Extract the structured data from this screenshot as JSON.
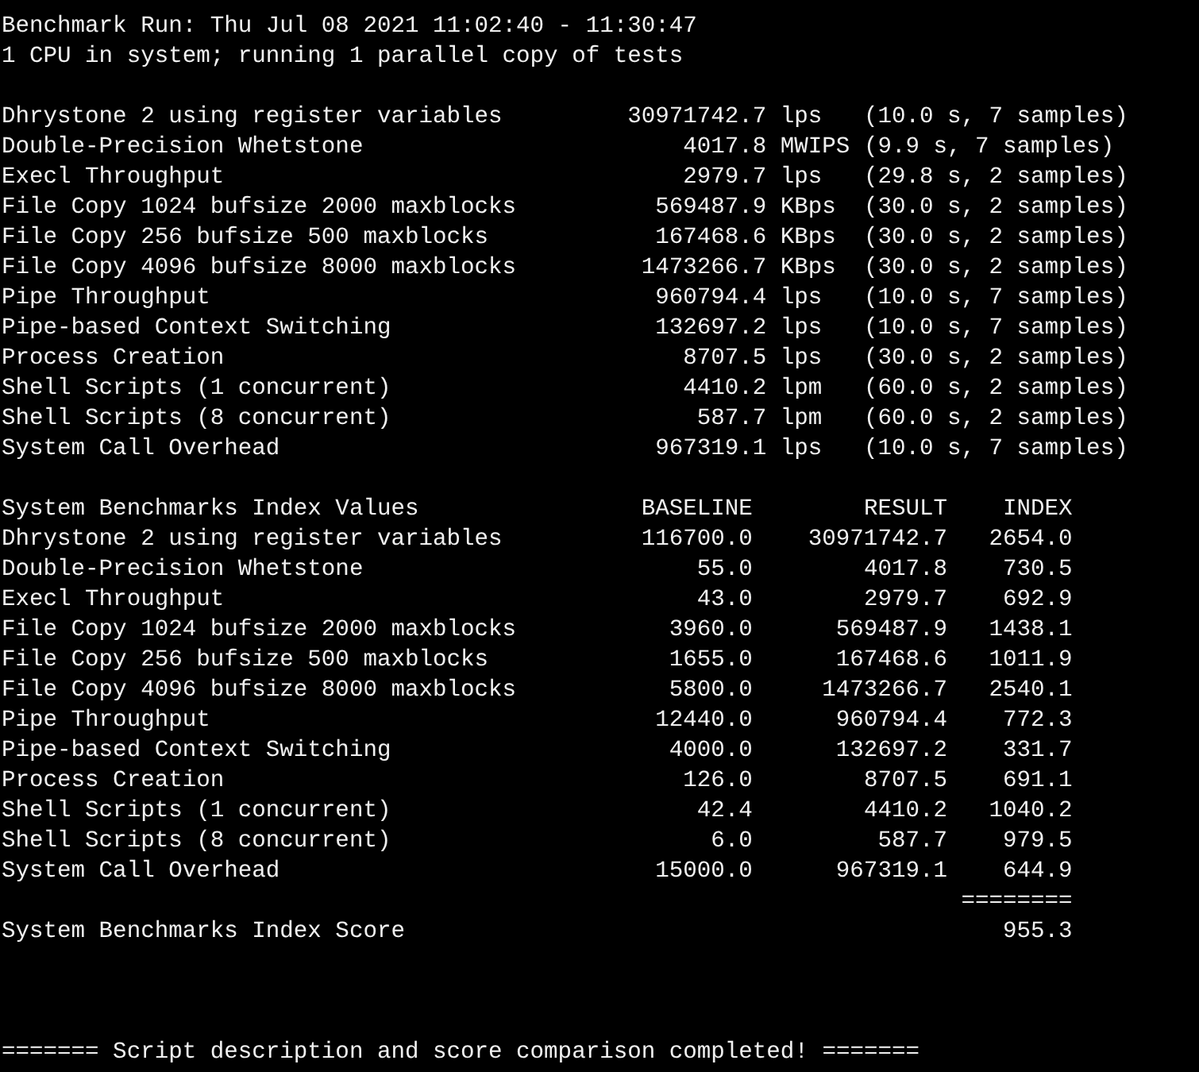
{
  "header_lines": [
    "Benchmark Run: Thu Jul 08 2021 11:02:40 - 11:30:47",
    "1 CPU in system; running 1 parallel copy of tests"
  ],
  "results": [
    {
      "name": "Dhrystone 2 using register variables",
      "value": "30971742.7",
      "unit": "lps",
      "detail": "(10.0 s, 7 samples)"
    },
    {
      "name": "Double-Precision Whetstone",
      "value": "4017.8",
      "unit": "MWIPS",
      "detail": "(9.9 s, 7 samples)"
    },
    {
      "name": "Execl Throughput",
      "value": "2979.7",
      "unit": "lps",
      "detail": "(29.8 s, 2 samples)"
    },
    {
      "name": "File Copy 1024 bufsize 2000 maxblocks",
      "value": "569487.9",
      "unit": "KBps",
      "detail": "(30.0 s, 2 samples)"
    },
    {
      "name": "File Copy 256 bufsize 500 maxblocks",
      "value": "167468.6",
      "unit": "KBps",
      "detail": "(30.0 s, 2 samples)"
    },
    {
      "name": "File Copy 4096 bufsize 8000 maxblocks",
      "value": "1473266.7",
      "unit": "KBps",
      "detail": "(30.0 s, 2 samples)"
    },
    {
      "name": "Pipe Throughput",
      "value": "960794.4",
      "unit": "lps",
      "detail": "(10.0 s, 7 samples)"
    },
    {
      "name": "Pipe-based Context Switching",
      "value": "132697.2",
      "unit": "lps",
      "detail": "(10.0 s, 7 samples)"
    },
    {
      "name": "Process Creation",
      "value": "8707.5",
      "unit": "lps",
      "detail": "(30.0 s, 2 samples)"
    },
    {
      "name": "Shell Scripts (1 concurrent)",
      "value": "4410.2",
      "unit": "lpm",
      "detail": "(60.0 s, 2 samples)"
    },
    {
      "name": "Shell Scripts (8 concurrent)",
      "value": "587.7",
      "unit": "lpm",
      "detail": "(60.0 s, 2 samples)"
    },
    {
      "name": "System Call Overhead",
      "value": "967319.1",
      "unit": "lps",
      "detail": "(10.0 s, 7 samples)"
    }
  ],
  "index_table": {
    "columns": [
      "System Benchmarks Index Values",
      "BASELINE",
      "RESULT",
      "INDEX"
    ],
    "rows": [
      [
        "Dhrystone 2 using register variables",
        "116700.0",
        "30971742.7",
        "2654.0"
      ],
      [
        "Double-Precision Whetstone",
        "55.0",
        "4017.8",
        "730.5"
      ],
      [
        "Execl Throughput",
        "43.0",
        "2979.7",
        "692.9"
      ],
      [
        "File Copy 1024 bufsize 2000 maxblocks",
        "3960.0",
        "569487.9",
        "1438.1"
      ],
      [
        "File Copy 256 bufsize 500 maxblocks",
        "1655.0",
        "167468.6",
        "1011.9"
      ],
      [
        "File Copy 4096 bufsize 8000 maxblocks",
        "5800.0",
        "1473266.7",
        "2540.1"
      ],
      [
        "Pipe Throughput",
        "12440.0",
        "960794.4",
        "772.3"
      ],
      [
        "Pipe-based Context Switching",
        "4000.0",
        "132697.2",
        "331.7"
      ],
      [
        "Process Creation",
        "126.0",
        "8707.5",
        "691.1"
      ],
      [
        "Shell Scripts (1 concurrent)",
        "42.4",
        "4410.2",
        "1040.2"
      ],
      [
        "Shell Scripts (8 concurrent)",
        "6.0",
        "587.7",
        "979.5"
      ],
      [
        "System Call Overhead",
        "15000.0",
        "967319.1",
        "644.9"
      ]
    ],
    "separator": "========",
    "score": {
      "label": "System Benchmarks Index Score",
      "value": "955.3"
    }
  },
  "footer": "======= Script description and score comparison completed! ======="
}
